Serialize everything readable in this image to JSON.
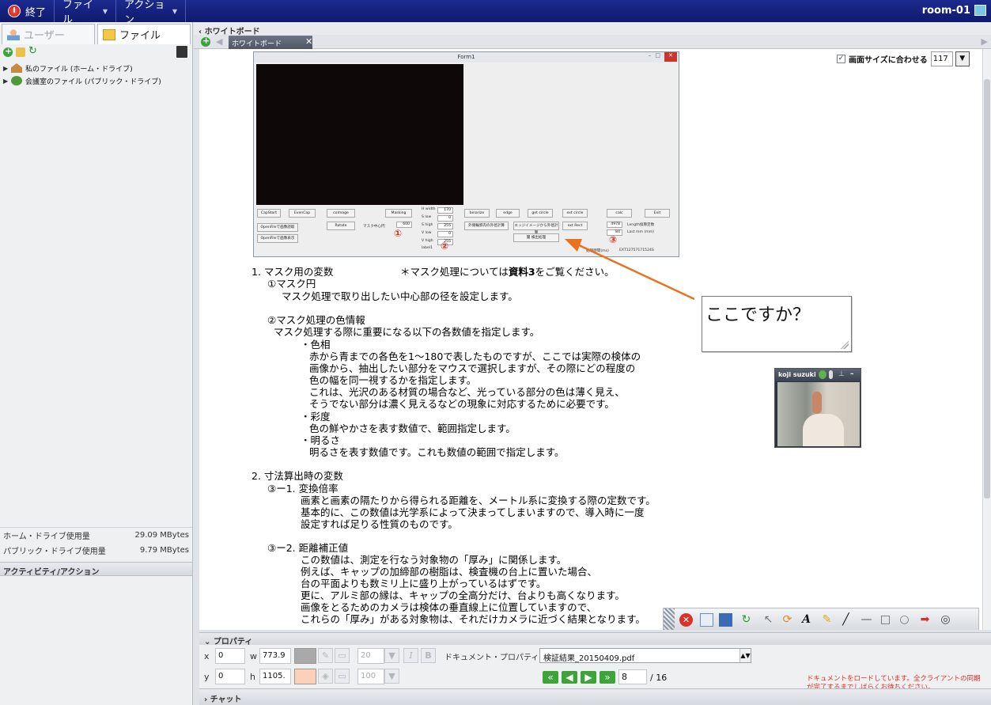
{
  "topbar": {
    "exit_label": "終了",
    "file_menu": "ファイル",
    "action_menu": "アクション",
    "room": "room-01"
  },
  "left": {
    "tab_user": "ユーザー",
    "tab_file": "ファイル",
    "tree": [
      "私のファイル (ホーム・ドライブ)",
      "会議室のファイル (パブリック・ドライブ)"
    ],
    "usage": [
      {
        "label": "ホーム・ドライブ使用量",
        "value": "29.09 MBytes"
      },
      {
        "label": "パブリック・ドライブ使用量",
        "value": "9.79 MBytes"
      }
    ],
    "activity_title": "アクティビティ/アクション"
  },
  "whiteboard": {
    "title": "ホワイトボード",
    "tab_label": "ホワイトボード",
    "fit_label": "画面サイズに合わせる",
    "zoom": "117"
  },
  "form1": {
    "title": "Form1",
    "buttons_row1": [
      "CapStart",
      "EvenCap",
      "coImage",
      "Masking",
      "binarize",
      "edge",
      "get circle",
      "ext circle",
      "calc",
      "Exit"
    ],
    "buttons_row2": [
      "OpenFileで画像読取",
      "Rotate",
      "外側輪郭内の外径計算",
      "エッジイメージから外径計算",
      "ext Rect"
    ],
    "buttons_row3": [
      "OpenFileで画像表示",
      "閾 検出処理"
    ],
    "labels": {
      "h_width": "H width",
      "s_low": "S low",
      "s_high": "S high",
      "v_low": "V low",
      "v_high": "V high",
      "mask_center": "マスク中心円",
      "label1": "label1",
      "length": "Length換算定数",
      "last_mm": "Last mm (mm)",
      "measure": "処理時間(ms)",
      "measure_val": "EXT12757171524S"
    },
    "values": {
      "h_width": "170",
      "s_low": "0",
      "s_high": "255",
      "v_low": "0",
      "v_high": "255",
      "mask": "600",
      "length": "4978",
      "last_mm": "84"
    },
    "circles": [
      "①",
      "②",
      "③"
    ]
  },
  "doc": {
    "l1": "1. マスク用の変数",
    "l1b": "＊マスク処理については",
    "l1c": "資料3",
    "l1d": "をご覧ください。",
    "l2": "①マスク円",
    "l3": "マスク処理で取り出したい中心部の径を設定します。",
    "l4": "②マスク処理の色情報",
    "l5": "マスク処理する際に重要になる以下の各数値を指定します。",
    "l6": "・色相",
    "l7": "赤から青までの各色を1～180で表したものですが、ここでは実際の検体の",
    "l8": "画像から、抽出したい部分をマウスで選択しますが、その際にどの程度の",
    "l9": "色の幅を同一視するかを指定します。",
    "l10": "これは、光沢のある材質の場合など、光っている部分の色は薄く見え、",
    "l11": "そうでない部分は濃く見えるなどの現象に対応するために必要です。",
    "l12": "・彩度",
    "l13": "色の鮮やかさを表す数値で、範囲指定します。",
    "l14": "・明るさ",
    "l15": "明るさを表す数値です。これも数値の範囲で指定します。",
    "l16": "2. 寸法算出時の変数",
    "l17": "③ー1. 変換倍率",
    "l18": "画素と画素の隔たりから得られる距離を、メートル系に変換する際の定数です。",
    "l19": "基本的に、この数値は光学系によって決まってしまいますので、導入時に一度",
    "l20": "設定すれば足りる性質のものです。",
    "l21": "③ー2. 距離補正値",
    "l22": "この数値は、測定を行なう対象物の「厚み」に関係します。",
    "l23": "例えば、キャップの加締部の樹脂は、検査機の台上に置いた場合、",
    "l24": "台の平面よりも数ミリ上に盛り上がっているはずです。",
    "l25": "更に、アルミ部の縁は、キャップの全高分だけ、台よりも高くなります。",
    "l26": "画像をとるためのカメラは検体の垂直線上に位置していますので、",
    "l27": "これらの「厚み」がある対象物は、それだけカメラに近づく結果となります。"
  },
  "callout": {
    "text": "ここですか？"
  },
  "video": {
    "user": "koji suzuki"
  },
  "properties": {
    "title": "プロパティ",
    "x_label": "x",
    "x_value": "0",
    "y_label": "y",
    "y_value": "0",
    "w_label": "w",
    "w_value": "773.9",
    "h_label": "h",
    "h_value": "1105.",
    "font_size": "20",
    "opacity": "100",
    "italic": "I",
    "bold": "B",
    "doc_prop_label": "ドキュメント・プロパティ",
    "doc_file": "検証結果_20150409.pdf",
    "page": "8",
    "page_total": "/ 16",
    "loading_msg_1": "ドキュメントをロードしています。全クライアントの同期",
    "loading_msg_2": "が完了するまでしばらくお待ちください。"
  },
  "chat": {
    "title": "チャット"
  },
  "colors": {
    "topbar": "#1b2a8f",
    "stroke_swatch": "#a9a9a9",
    "fill_swatch": "#fcd1b8",
    "annotation_orange": "#e8731e",
    "circle_red": "#e03020"
  }
}
